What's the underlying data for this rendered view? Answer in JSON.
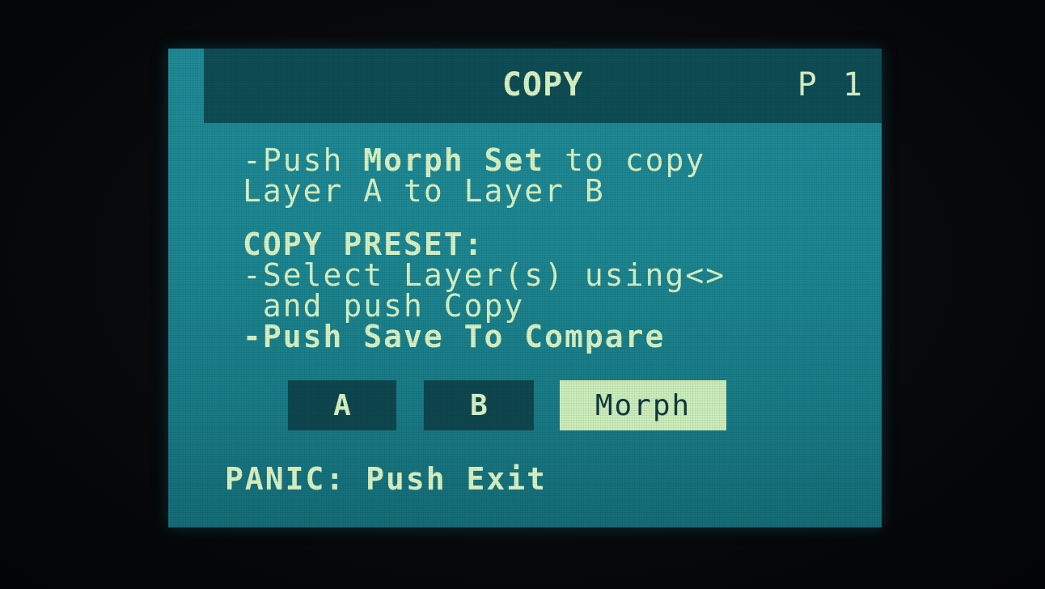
{
  "header": {
    "title": "COPY",
    "page": "P 1"
  },
  "instructions": {
    "line1_prefix": "-Push ",
    "line1_bold": "Morph Set",
    "line1_suffix": " to copy",
    "line2": "Layer A to Layer B",
    "copy_preset_heading": "COPY PRESET:",
    "line4": "-Select Layer(s) using<>",
    "line5": " and push Copy",
    "line6": "-Push Save To Compare"
  },
  "layers": {
    "a_label": "A",
    "b_label": "B",
    "morph_label": "Morph",
    "selected": "Morph"
  },
  "footer": {
    "panic": "PANIC: Push Exit"
  },
  "colors": {
    "screen": "#1d8792",
    "header_bar": "#0f4d55",
    "text": "#d9f3c4",
    "button_bg": "#0f474f",
    "selected_bg": "#cdeebc"
  }
}
